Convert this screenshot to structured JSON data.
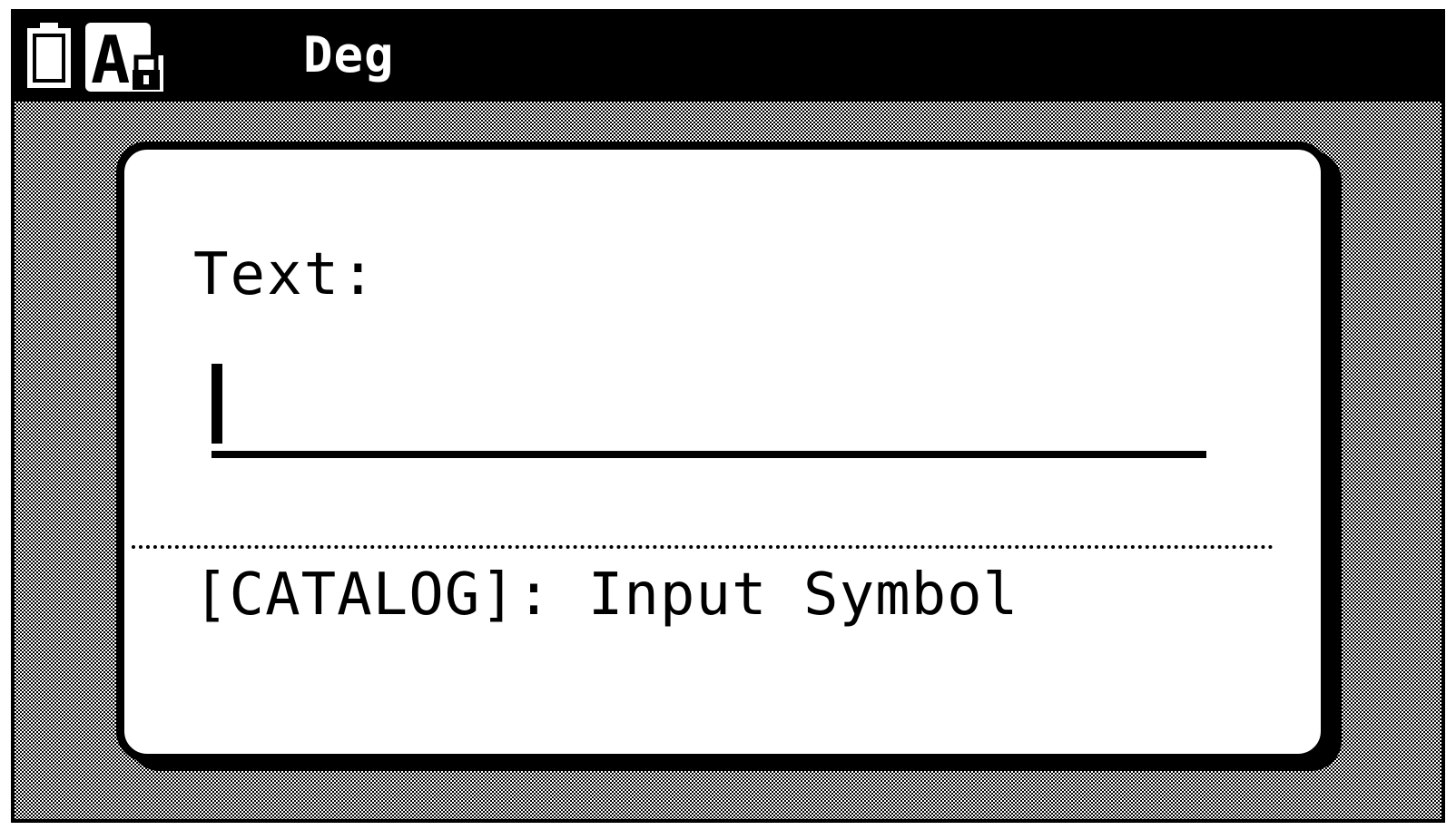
{
  "status_bar": {
    "battery_icon": "battery-icon",
    "alpha_lock_icon": "alpha-lock-icon",
    "angle_mode": "Deg"
  },
  "dialog": {
    "prompt_label": "Text:",
    "text_value": "",
    "hint": "[CATALOG]: Input Symbol"
  },
  "colors": {
    "foreground": "#000000",
    "background": "#ffffff"
  }
}
